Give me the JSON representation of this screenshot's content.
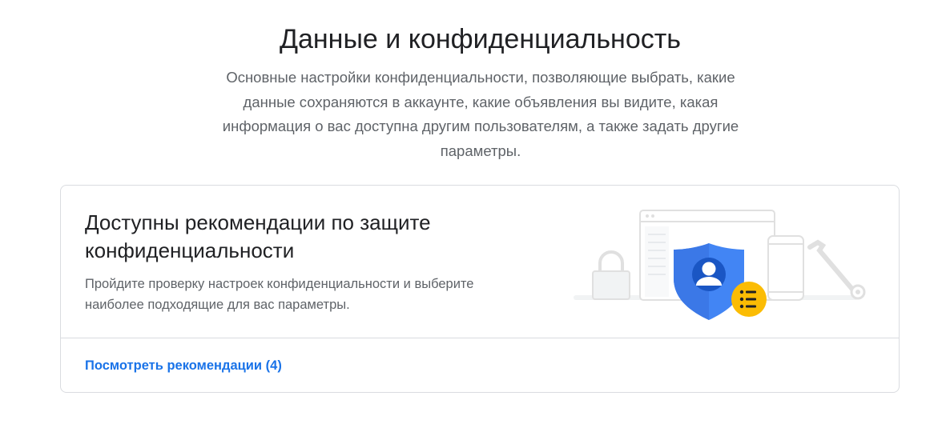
{
  "header": {
    "title": "Данные и конфиденциальность",
    "subtitle_lines": [
      "Основные настройки конфиденциальности, позволяющие выбрать, какие",
      "данные сохраняются в аккаунте, какие объявления вы видите, какая",
      "информация о вас доступна другим пользователям, а также задать другие",
      "параметры."
    ]
  },
  "card": {
    "title_lines": [
      "Доступны рекомендации по защите",
      "конфиденциальности"
    ],
    "description_lines": [
      "Пройдите проверку настроек конфиденциальности и выберите",
      "наиболее подходящие для вас параметры."
    ],
    "link_label": "Посмотреть рекомендации (4)"
  },
  "colors": {
    "accent_blue": "#1a73e8",
    "shield_blue": "#4285f4",
    "badge_yellow": "#fbbc04"
  },
  "icons": {
    "illustration": "privacy-checkup-illustration",
    "lock": "lock-icon",
    "shield": "shield-person-icon",
    "badge": "list-badge-icon",
    "wrench": "wrench-icon"
  }
}
